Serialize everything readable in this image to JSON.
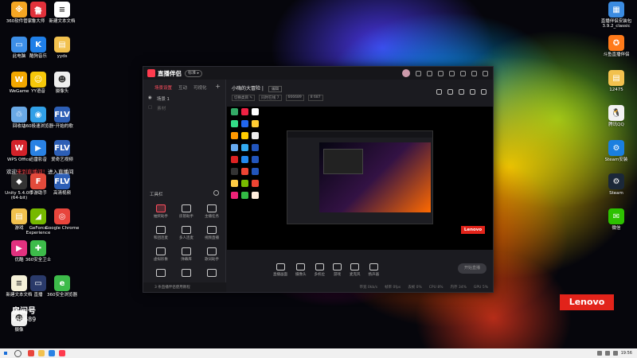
{
  "desktop": {
    "left_icons": [
      {
        "label": "360软件管家",
        "color": "#f5a623",
        "glyph": "※"
      },
      {
        "label": "鲁大师",
        "color": "#e2313b",
        "glyph": "鲁"
      },
      {
        "label": "新建文本文档",
        "color": "#ffffff",
        "glyph": "≡"
      },
      {
        "label": "此电脑",
        "color": "#3d8fe8",
        "glyph": "▭"
      },
      {
        "label": "酷狗音乐",
        "color": "#1f7fe8",
        "glyph": "K"
      },
      {
        "label": "yyds",
        "color": "#f2c14e",
        "glyph": "▤"
      },
      {
        "label": "WeGame",
        "color": "#f2a700",
        "glyph": "W"
      },
      {
        "label": "YY语音",
        "color": "#f6c80a",
        "glyph": "☺"
      },
      {
        "label": "摄像头",
        "color": "#eee",
        "glyph": "☻"
      },
      {
        "label": "回收站",
        "color": "#6aa9e6",
        "glyph": "♲"
      },
      {
        "label": "360极速浏览器",
        "color": "#31a0e8",
        "glyph": "◉"
      },
      {
        "label": "一开始的歌",
        "color": "#2d5fb6",
        "glyph": "FLV"
      },
      {
        "label": "WPS Office",
        "color": "#d3222a",
        "glyph": "W"
      },
      {
        "label": "迅雷影音",
        "color": "#2a82e4",
        "glyph": "▶"
      },
      {
        "label": "爱奇艺视频",
        "color": "#2d5fb6",
        "glyph": "FLV"
      },
      {
        "label": "Unity 5.4.0f3 (64-bit)",
        "color": "#333",
        "glyph": "◆"
      },
      {
        "label": "手游助手",
        "color": "#e24a3b",
        "glyph": "F"
      },
      {
        "label": "高清视频",
        "color": "#2d5fb6",
        "glyph": "FLV"
      },
      {
        "label": "游戏",
        "color": "#f2c14e",
        "glyph": "▤"
      },
      {
        "label": "GeForce Experience",
        "color": "#76b900",
        "glyph": "◢"
      },
      {
        "label": "Google Chrome",
        "color": "#e8453c",
        "glyph": "◎"
      },
      {
        "label": "优酷",
        "color": "#e2317f",
        "glyph": "▶"
      },
      {
        "label": "360安全卫士",
        "color": "#3dbb4a",
        "glyph": "✚"
      },
      {
        "label": "新建文本文档",
        "color": "#f4f0d8",
        "glyph": "≡"
      },
      {
        "label": "直播",
        "color": "#2a3a6a",
        "glyph": "▭"
      },
      {
        "label": "360安全浏览器",
        "color": "#3dbb4a",
        "glyph": "e"
      },
      {
        "label": "摄像",
        "color": "#eee",
        "glyph": "☻"
      }
    ],
    "right_icons": [
      {
        "label": "直播伴侣安装包 3.9.2_classic",
        "color": "#3b8be0",
        "glyph": "▦"
      },
      {
        "label": "斗鱼直播伴侣",
        "color": "#ff7a1a",
        "glyph": "✪"
      },
      {
        "label": "12475",
        "color": "#f2c14e",
        "glyph": "▤"
      },
      {
        "label": "腾讯QQ",
        "color": "#f2f2f2",
        "glyph": "🐧"
      },
      {
        "label": "Steam安装",
        "color": "#1a7fe0",
        "glyph": "⚙"
      },
      {
        "label": "Steam",
        "color": "#1b2838",
        "glyph": "⚙"
      },
      {
        "label": "微信",
        "color": "#2dc100",
        "glyph": "✉"
      }
    ],
    "overlay_text_prefix": "欢迎",
    "overlay_text_highlight": "来到直播间！",
    "overlay_text_suffix": "进入直播间",
    "room_name": "房间号",
    "room_id": "666689",
    "brand": "Lenovo"
  },
  "app": {
    "name": "直播伴侣",
    "version": "标准 ▸",
    "sidebar_tabs": [
      "场景设置",
      "互动",
      "可视化"
    ],
    "scene_name": "场景 1",
    "scene_sub": "素材",
    "tools_title": "工具栏",
    "tools": [
      "抽奖助手",
      "房管助手",
      "主播任务",
      "和团连麦",
      "多人连麦",
      "视频直播",
      "虚拟形象",
      "弹幕库",
      "歌词助手",
      "",
      "",
      ""
    ],
    "sidebar_footer": "3 条直播伴侣使用教程",
    "room_title": "小嗨的大冒险 |",
    "room_edit": "编辑",
    "room_meta": [
      "切换类目 ✎",
      "同时在线 7",
      "666689",
      "8 687"
    ],
    "controls": [
      "直播画面",
      "摄像头",
      "多机位",
      "游戏",
      "麦克风",
      "扬声器"
    ],
    "start_live": "开始直播",
    "status": [
      "带宽 0kb/s",
      "帧率 0fps",
      "丢帧 0%",
      "CPU 8%",
      "内存 34%",
      "GPU 5%"
    ],
    "canvas_brand": "Lenovo"
  },
  "taskbar": {
    "apps": [
      "#e8453c",
      "#f2c14e",
      "#2a82e4",
      "#ff3b4e"
    ],
    "time": "19:56"
  }
}
